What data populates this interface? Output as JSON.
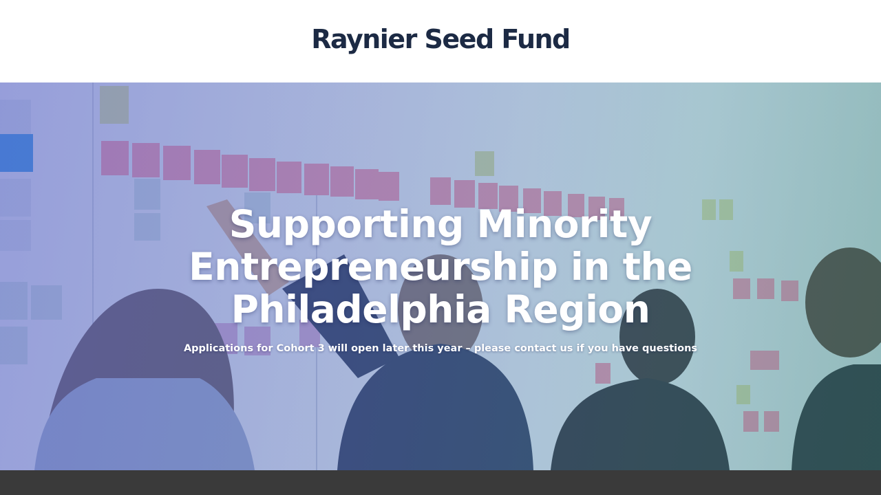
{
  "header": {
    "logo": "Raynier Seed Fund"
  },
  "hero": {
    "title": "Supporting Minority Entrepreneurship in the Philadelphia Region",
    "subtitle": "Applications for Cohort 3 will open later this year – please contact us if you have questions"
  },
  "colors": {
    "logo_text": "#1c2a44",
    "hero_overlay": "#6a78c8",
    "footer": "#3a3a3a"
  }
}
